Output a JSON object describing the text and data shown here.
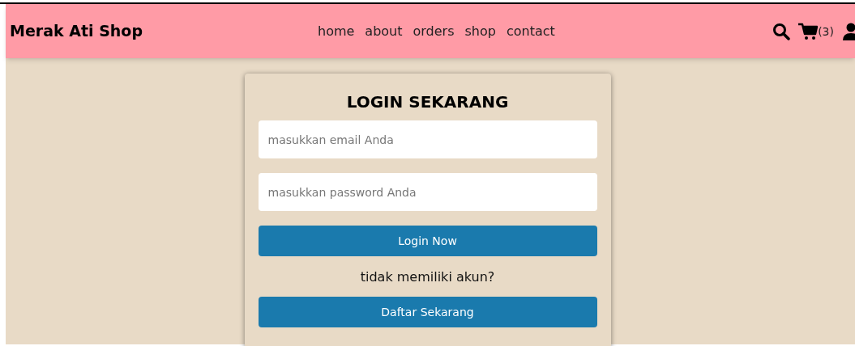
{
  "navbar": {
    "brand": "Merak Ati Shop",
    "links": [
      {
        "label": "home"
      },
      {
        "label": "about"
      },
      {
        "label": "orders"
      },
      {
        "label": "shop"
      },
      {
        "label": "contact"
      }
    ],
    "cart_count": "(3)"
  },
  "login_form": {
    "title": "LOGIN SEKARANG",
    "fields": [
      {
        "placeholder": "masukkan email Anda"
      },
      {
        "placeholder": "masukkan password Anda"
      }
    ],
    "submit": "Login Now",
    "prompt": "tidak memiliki akun?",
    "register": "Daftar Sekarang"
  }
}
